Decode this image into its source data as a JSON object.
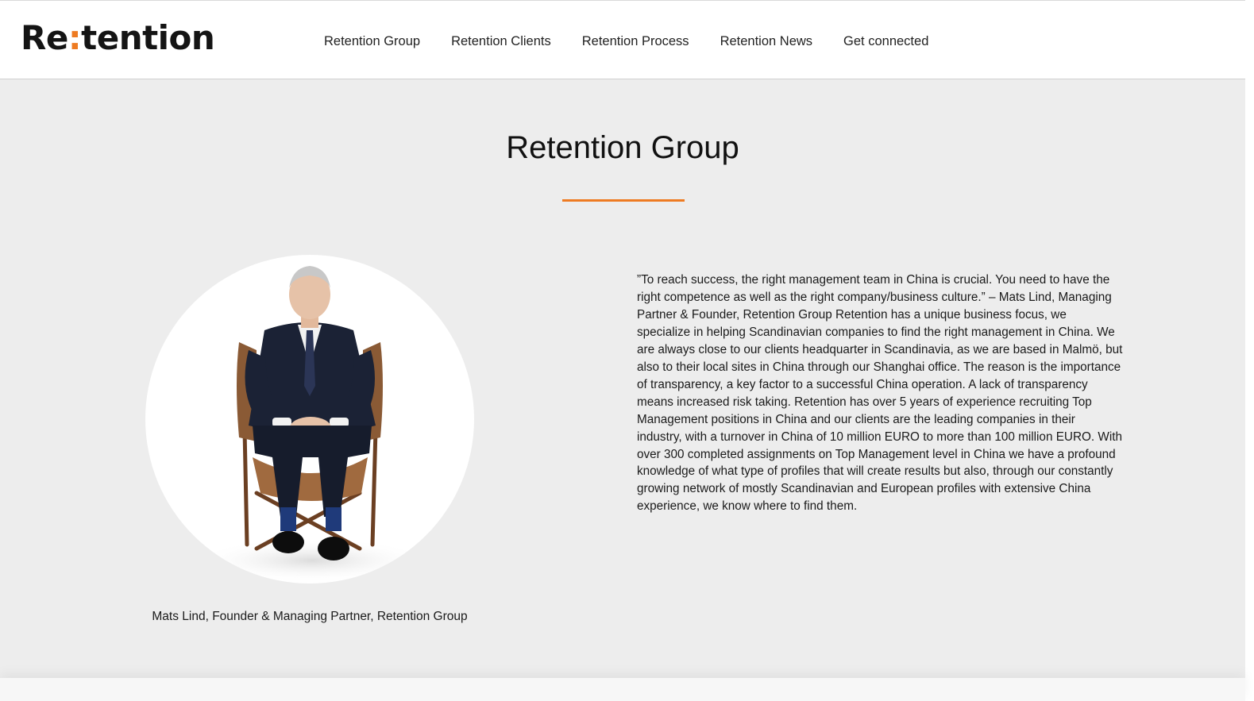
{
  "brand": {
    "logo_part1": "Re",
    "logo_colon": ":",
    "logo_part2": "tention",
    "accent_color": "#ee7b22"
  },
  "nav": {
    "items": [
      {
        "label": "Retention Group"
      },
      {
        "label": "Retention Clients"
      },
      {
        "label": "Retention Process"
      },
      {
        "label": "Retention News"
      },
      {
        "label": "Get connected"
      }
    ]
  },
  "main": {
    "title": "Retention Group",
    "portrait_icon": "person-portrait-image",
    "caption": "Mats Lind, Founder & Managing Partner, Retention Group",
    "quote": "”To reach success, the right management team in China is crucial. You need to have the right competence as well as the right company/business culture.” – Mats Lind, Managing Partner & Founder, Retention Group Retention has a unique business focus, we specialize in helping Scandinavian companies to find the right management in China. We are always close to our clients headquarter in Scandinavia, as we are based in Malmö, but also to their local sites in China through our Shanghai office. The reason is the importance of transparency, a key factor to a successful China operation. A lack of transparency means increased risk taking. Retention has over 5 years of experience recruiting Top Management positions in China and our clients are the leading companies in their industry, with a turnover in China of 10 million EURO to more than 100 million EURO. With over 300 completed assignments on Top Management level in China we have a profound knowledge of what type of profiles that will create results but also, through our constantly growing network of mostly Scandinavian and European profiles with extensive China experience, we know where to find them."
  }
}
